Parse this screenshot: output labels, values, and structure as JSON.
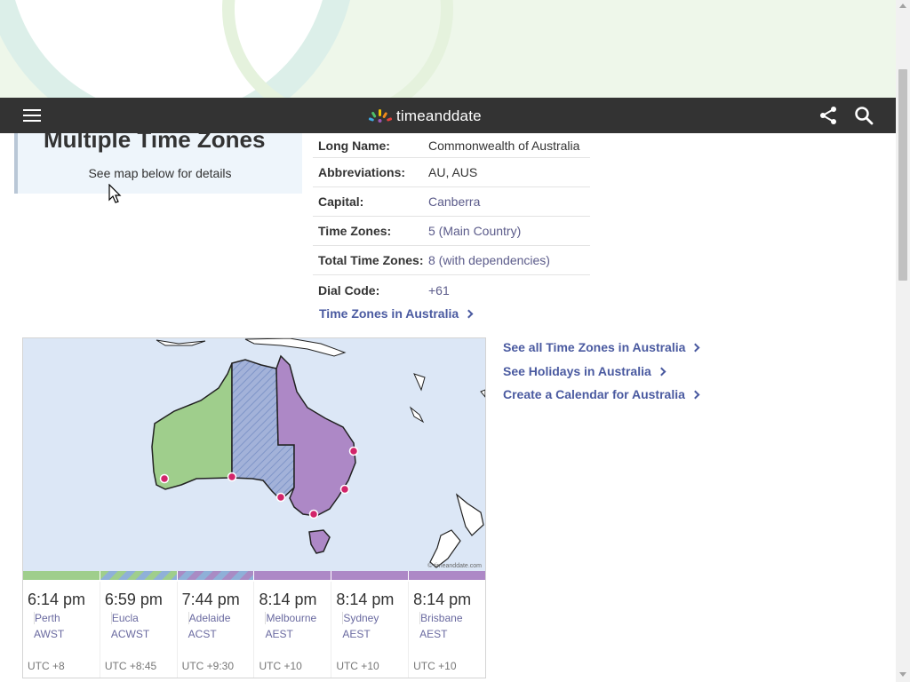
{
  "header": {
    "logo_text": "timeanddate"
  },
  "tz_card": {
    "title": "Multiple Time Zones",
    "subtitle": "See map below for details"
  },
  "info": {
    "rows": [
      {
        "label": "Long Name:",
        "value": "Commonwealth of Australia"
      },
      {
        "label": "Abbreviations:",
        "value": "AU, AUS"
      },
      {
        "label": "Capital:",
        "value": "Canberra"
      },
      {
        "label": "Time Zones:",
        "value": "5 (Main Country)"
      },
      {
        "label": "Total Time Zones:",
        "value": "8 (with dependencies)"
      },
      {
        "label": "Dial Code:",
        "value": "+61"
      }
    ],
    "link": "Time Zones in Australia"
  },
  "side_links": [
    "See all Time Zones in Australia",
    "See Holidays in Australia",
    "Create a Calendar for Australia"
  ],
  "map": {
    "credit": "© timeanddate.com",
    "colors": {
      "ocean": "#dce7f6",
      "west": "#9fce8c",
      "central": "#a3b2d9",
      "east": "#ad88c6",
      "dot": "#d2246a"
    }
  },
  "cities": [
    {
      "time": "6:14 pm",
      "name": "Perth",
      "abbr": "AWST",
      "utc": "UTC +8"
    },
    {
      "time": "6:59 pm",
      "name": "Eucla",
      "abbr": "ACWST",
      "utc": "UTC +8:45"
    },
    {
      "time": "7:44 pm",
      "name": "Adelaide",
      "abbr": "ACST",
      "utc": "UTC +9:30"
    },
    {
      "time": "8:14 pm",
      "name": "Melbourne",
      "abbr": "AEST",
      "utc": "UTC +10"
    },
    {
      "time": "8:14 pm",
      "name": "Sydney",
      "abbr": "AEST",
      "utc": "UTC +10"
    },
    {
      "time": "8:14 pm",
      "name": "Brisbane",
      "abbr": "AEST",
      "utc": "UTC +10"
    }
  ]
}
